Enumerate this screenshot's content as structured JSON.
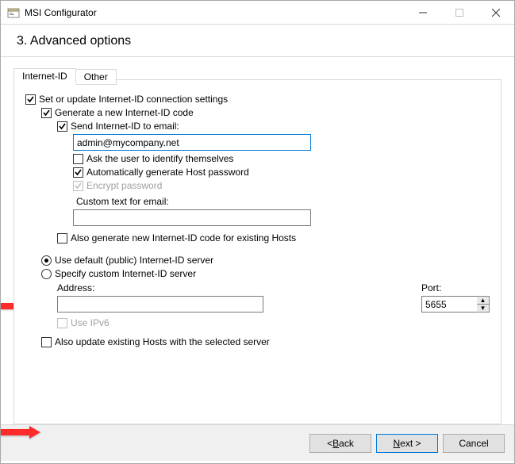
{
  "window": {
    "title": "MSI Configurator"
  },
  "header": {
    "step_title": "3. Advanced options"
  },
  "tabs": {
    "items": [
      {
        "label": "Internet-ID"
      },
      {
        "label": "Other"
      }
    ]
  },
  "panel": {
    "set_or_update_label": "Set or update Internet-ID connection settings",
    "generate_new_label": "Generate a new Internet-ID code",
    "send_email_label": "Send Internet-ID to email:",
    "email_value": "admin@mycompany.net",
    "ask_user_label": "Ask the user to identify themselves",
    "auto_host_pwd_label": "Automatically generate Host password",
    "encrypt_pwd_label": "Encrypt password",
    "custom_text_label": "Custom text for email:",
    "custom_text_value": "",
    "also_generate_label": "Also generate new Internet-ID code for existing Hosts",
    "use_default_server_label": "Use default (public) Internet-ID server",
    "specify_custom_server_label": "Specify custom Internet-ID server",
    "address_label": "Address:",
    "address_value": "",
    "port_label": "Port:",
    "port_value": "5655",
    "use_ipv6_label": "Use IPv6",
    "also_update_label": "Also update existing Hosts with the selected server"
  },
  "footer": {
    "back_pre": "< ",
    "back_mn": "B",
    "back_post": "ack",
    "next_mn": "N",
    "next_post": "ext >",
    "cancel_label": "Cancel"
  }
}
